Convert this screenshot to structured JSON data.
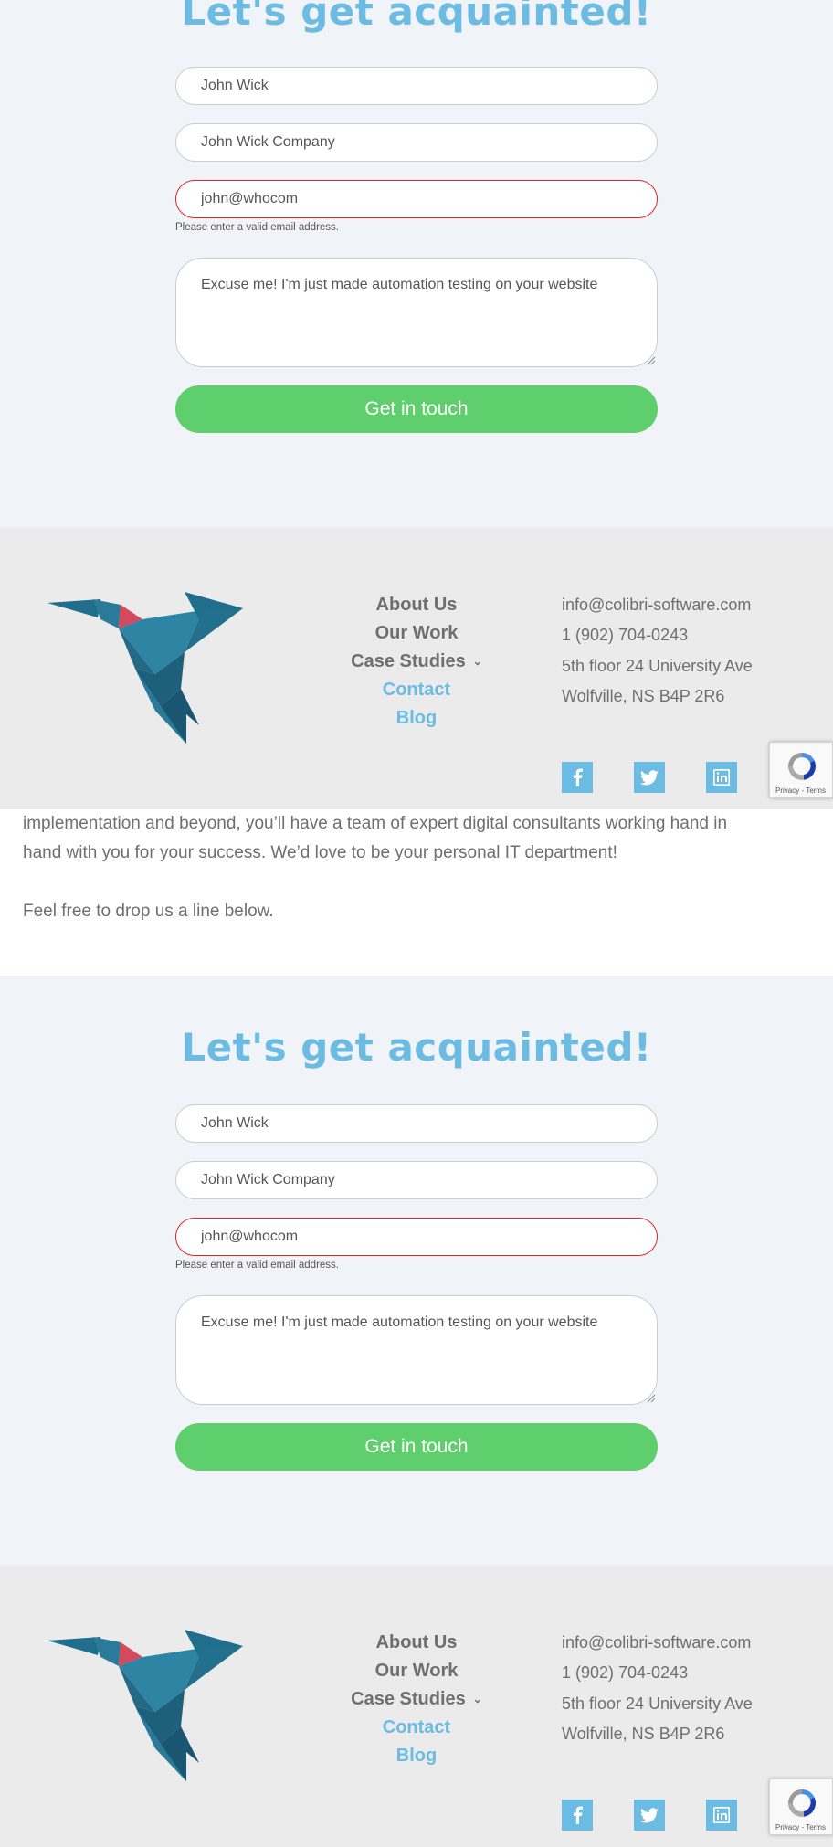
{
  "form": {
    "title": "Let's get acquainted!",
    "name_value": "John Wick",
    "company_value": "John Wick Company",
    "email_value": "john@whocom",
    "email_error": "Please enter a valid email address.",
    "message_value": "Excuse me! I'm just made automation testing on your website",
    "submit_label": "Get in touch"
  },
  "footer": {
    "nav": [
      "About Us",
      "Our Work",
      "Case Studies",
      "Contact",
      "Blog"
    ],
    "email": "info@colibri-software.com",
    "phone": "1 (902) 704-0243",
    "address_line1": "5th floor 24 University Ave",
    "address_line2": "Wolfville, NS B4P 2R6",
    "social": [
      "facebook-icon",
      "twitter-icon",
      "linkedin-icon"
    ]
  },
  "recaptcha": {
    "terms": "Privacy - Terms"
  },
  "about": {
    "line1": "implementation and beyond, you’ll have a team of expert digital consultants working hand in",
    "line2": "hand with you for your success. We’d love to be your personal IT department!",
    "line3": "Feel free to drop us a line below."
  },
  "colors": {
    "accent_blue": "#6bbbe3",
    "green": "#5ecf6c",
    "error_red": "#d9232e"
  }
}
